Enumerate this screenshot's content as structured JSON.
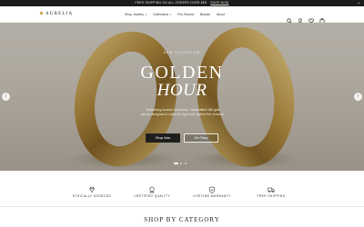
{
  "promo": {
    "text": "FREE SHIPPING ON ALL ORDERS OVER $85",
    "link": "SHOP NOW",
    "close": "×"
  },
  "header": {
    "brand": "AURELIA",
    "nav": [
      {
        "label": "Shop Jewelry",
        "dropdown": true
      },
      {
        "label": "Collections",
        "dropdown": true
      },
      {
        "label": "Pre-Owned",
        "dropdown": false
      },
      {
        "label": "Brands",
        "dropdown": false
      },
      {
        "label": "About",
        "dropdown": false
      }
    ],
    "icons": [
      "search-icon",
      "user-icon",
      "heart-icon",
      "cart-icon"
    ]
  },
  "hero": {
    "eyebrow": "NEW COLLECTION",
    "title_line1": "GOLDEN",
    "title_line2": "HOUR",
    "description": "Redefining modern heirlooms. Handcrafted 18k gold pieces designed to catch the light and capture the moment.",
    "primary_button": "Shop Now",
    "secondary_button": "Our Story",
    "prev": "‹",
    "next": "›",
    "slide_count": 3,
    "active_slide": 1
  },
  "features": [
    {
      "label": "ETHICALLY SOURCED",
      "icon": "diamond-icon"
    },
    {
      "label": "CERTIFIED QUALITY",
      "icon": "certificate-icon"
    },
    {
      "label": "LIFETIME WARRANTY",
      "icon": "shield-icon"
    },
    {
      "label": "FREE SHIPPING",
      "icon": "truck-icon"
    }
  ],
  "section": {
    "title": "SHOP BY CATEGORY"
  },
  "colors": {
    "accent": "#c9a14a",
    "dark": "#1e1e1e",
    "gold": "#b8903f"
  }
}
